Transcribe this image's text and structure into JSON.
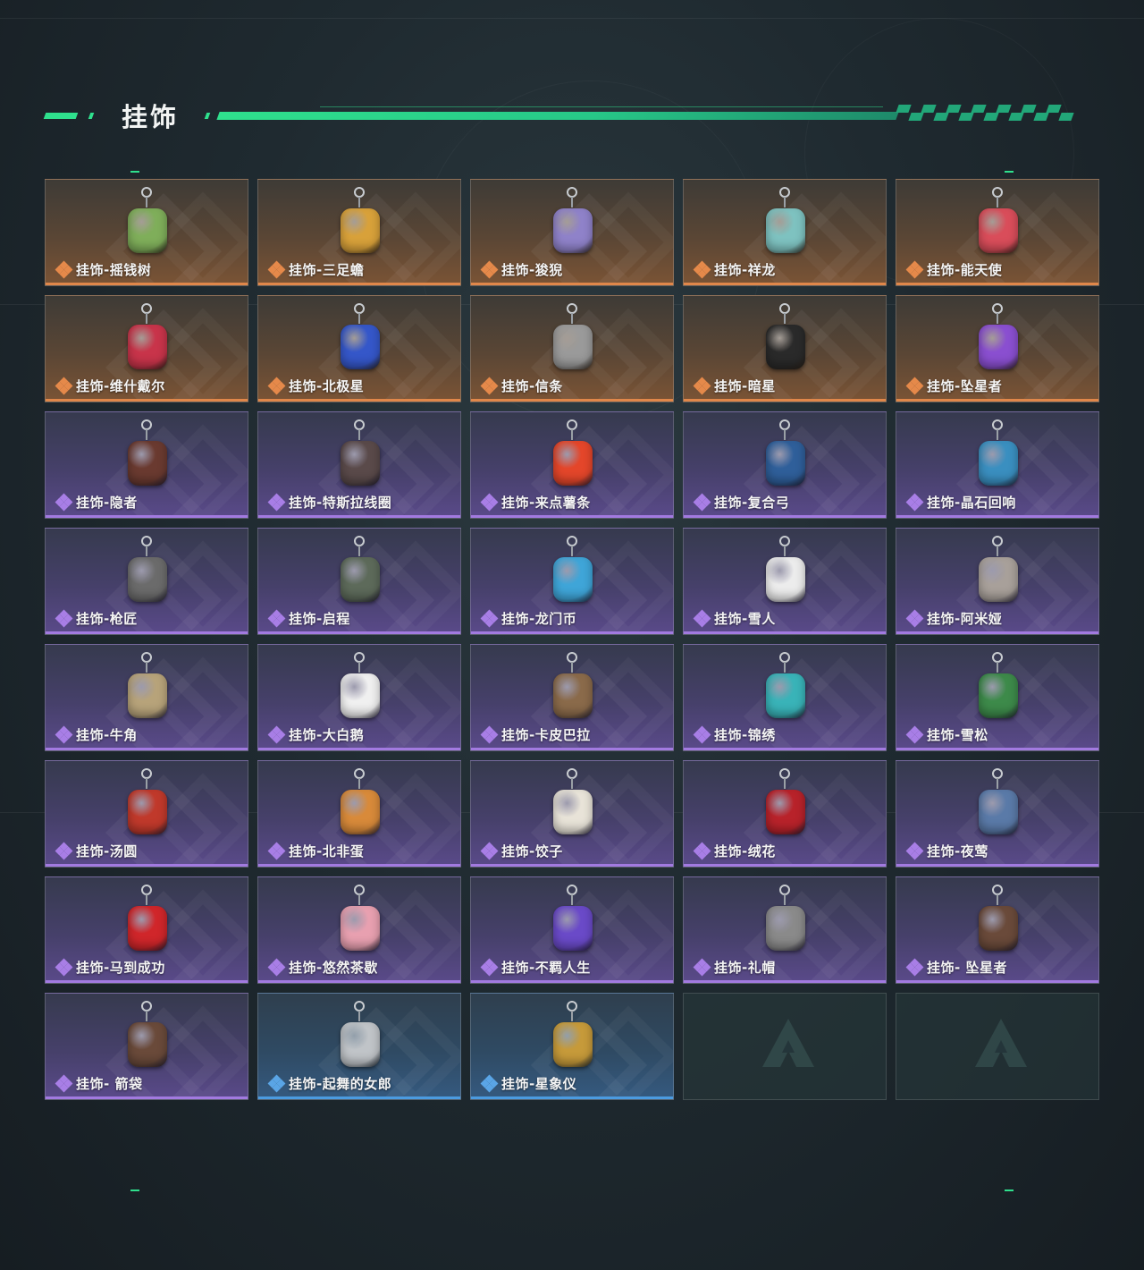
{
  "section": {
    "title": "挂饰"
  },
  "items": [
    {
      "label": "挂饰-摇钱树",
      "rarity": "orange",
      "icon": "money-tree-charm-icon",
      "color": "#7fae5a"
    },
    {
      "label": "挂饰-三足蟾",
      "rarity": "orange",
      "icon": "golden-toad-charm-icon",
      "color": "#d8a13a"
    },
    {
      "label": "挂饰-狻猊",
      "rarity": "orange",
      "icon": "lion-beast-charm-icon",
      "color": "#8f82c9"
    },
    {
      "label": "挂饰-祥龙",
      "rarity": "orange",
      "icon": "dragon-charm-icon",
      "color": "#7ec2c0"
    },
    {
      "label": "挂饰-能天使",
      "rarity": "orange",
      "icon": "tag-charm-icon",
      "color": "#d94d5a"
    },
    {
      "label": "挂饰-维什戴尔",
      "rarity": "orange",
      "icon": "tag-charm-icon",
      "color": "#c8344a"
    },
    {
      "label": "挂饰-北极星",
      "rarity": "orange",
      "icon": "blue-star-charm-icon",
      "color": "#3557c9"
    },
    {
      "label": "挂饰-信条",
      "rarity": "orange",
      "icon": "statue-charm-icon",
      "color": "#9a9a9a"
    },
    {
      "label": "挂饰-暗星",
      "rarity": "orange",
      "icon": "dark-star-charm-icon",
      "color": "#2a2a2a"
    },
    {
      "label": "挂饰-坠星者",
      "rarity": "orange",
      "icon": "purple-crystal-charm-icon",
      "color": "#8a4fd0"
    },
    {
      "label": "挂饰-隐者",
      "rarity": "purple",
      "icon": "card-charm-icon",
      "color": "#6a3a30"
    },
    {
      "label": "挂饰-特斯拉线圈",
      "rarity": "purple",
      "icon": "tesla-coil-charm-icon",
      "color": "#5a4a4a"
    },
    {
      "label": "挂饰-来点薯条",
      "rarity": "purple",
      "icon": "fries-charm-icon",
      "color": "#e4462a"
    },
    {
      "label": "挂饰-复合弓",
      "rarity": "purple",
      "icon": "bow-charm-icon",
      "color": "#2f5f9a"
    },
    {
      "label": "挂饰-晶石回响",
      "rarity": "purple",
      "icon": "crystal-charm-icon",
      "color": "#3a8fc0"
    },
    {
      "label": "挂饰-枪匠",
      "rarity": "purple",
      "icon": "gunsmith-charm-icon",
      "color": "#6b6b6b"
    },
    {
      "label": "挂饰-启程",
      "rarity": "purple",
      "icon": "medal-charm-icon",
      "color": "#5d6a5a"
    },
    {
      "label": "挂饰-龙门币",
      "rarity": "purple",
      "icon": "coin-card-charm-icon",
      "color": "#3fa5d8"
    },
    {
      "label": "挂饰-雪人",
      "rarity": "purple",
      "icon": "snowman-charm-icon",
      "color": "#ececec"
    },
    {
      "label": "挂饰-阿米娅",
      "rarity": "purple",
      "icon": "bunny-charm-icon",
      "color": "#a8a09a"
    },
    {
      "label": "挂饰-牛角",
      "rarity": "purple",
      "icon": "horns-charm-icon",
      "color": "#b7a37a"
    },
    {
      "label": "挂饰-大白鹅",
      "rarity": "purple",
      "icon": "goose-charm-icon",
      "color": "#f0f0f0"
    },
    {
      "label": "挂饰-卡皮巴拉",
      "rarity": "purple",
      "icon": "capybara-charm-icon",
      "color": "#8a6a4a"
    },
    {
      "label": "挂饰-锦绣",
      "rarity": "purple",
      "icon": "butterfly-charm-icon",
      "color": "#39b3b8"
    },
    {
      "label": "挂饰-雪松",
      "rarity": "purple",
      "icon": "pine-tree-charm-icon",
      "color": "#3d8a4a"
    },
    {
      "label": "挂饰-汤圆",
      "rarity": "purple",
      "icon": "rice-ball-bowl-charm-icon",
      "color": "#c0392b"
    },
    {
      "label": "挂饰-北非蛋",
      "rarity": "purple",
      "icon": "egg-dish-charm-icon",
      "color": "#d88a3a"
    },
    {
      "label": "挂饰-饺子",
      "rarity": "purple",
      "icon": "dumpling-plate-charm-icon",
      "color": "#e8e3d8"
    },
    {
      "label": "挂饰-绒花",
      "rarity": "purple",
      "icon": "rose-charm-icon",
      "color": "#b8222a"
    },
    {
      "label": "挂饰-夜莺",
      "rarity": "purple",
      "icon": "feather-charm-icon",
      "color": "#5a7aa8"
    },
    {
      "label": "挂饰-马到成功",
      "rarity": "purple",
      "icon": "red-horse-charm-icon",
      "color": "#d0262a"
    },
    {
      "label": "挂饰-悠然茶歇",
      "rarity": "purple",
      "icon": "cupcake-charm-icon",
      "color": "#e8a0b0"
    },
    {
      "label": "挂饰-不羁人生",
      "rarity": "purple",
      "icon": "sneaker-charm-icon",
      "color": "#6a4ac8"
    },
    {
      "label": "挂饰-礼帽",
      "rarity": "purple",
      "icon": "fedora-charm-icon",
      "color": "#8a8a8a"
    },
    {
      "label": "挂饰- 坠星者",
      "rarity": "purple",
      "icon": "triangle-eye-charm-icon",
      "color": "#6a4a3a"
    },
    {
      "label": "挂饰- 箭袋",
      "rarity": "purple",
      "icon": "quiver-charm-icon",
      "color": "#6a4a3a"
    },
    {
      "label": "挂饰-起舞的女郎",
      "rarity": "blue",
      "icon": "dancer-charm-icon",
      "color": "#c0c4c8"
    },
    {
      "label": "挂饰-星象仪",
      "rarity": "blue",
      "icon": "astrolabe-charm-icon",
      "color": "#c69a3a"
    },
    {
      "label": "",
      "rarity": "empty",
      "icon": "game-logo-icon",
      "color": "#3d5a58"
    },
    {
      "label": "",
      "rarity": "empty",
      "icon": "game-logo-icon",
      "color": "#3d5a58"
    }
  ]
}
